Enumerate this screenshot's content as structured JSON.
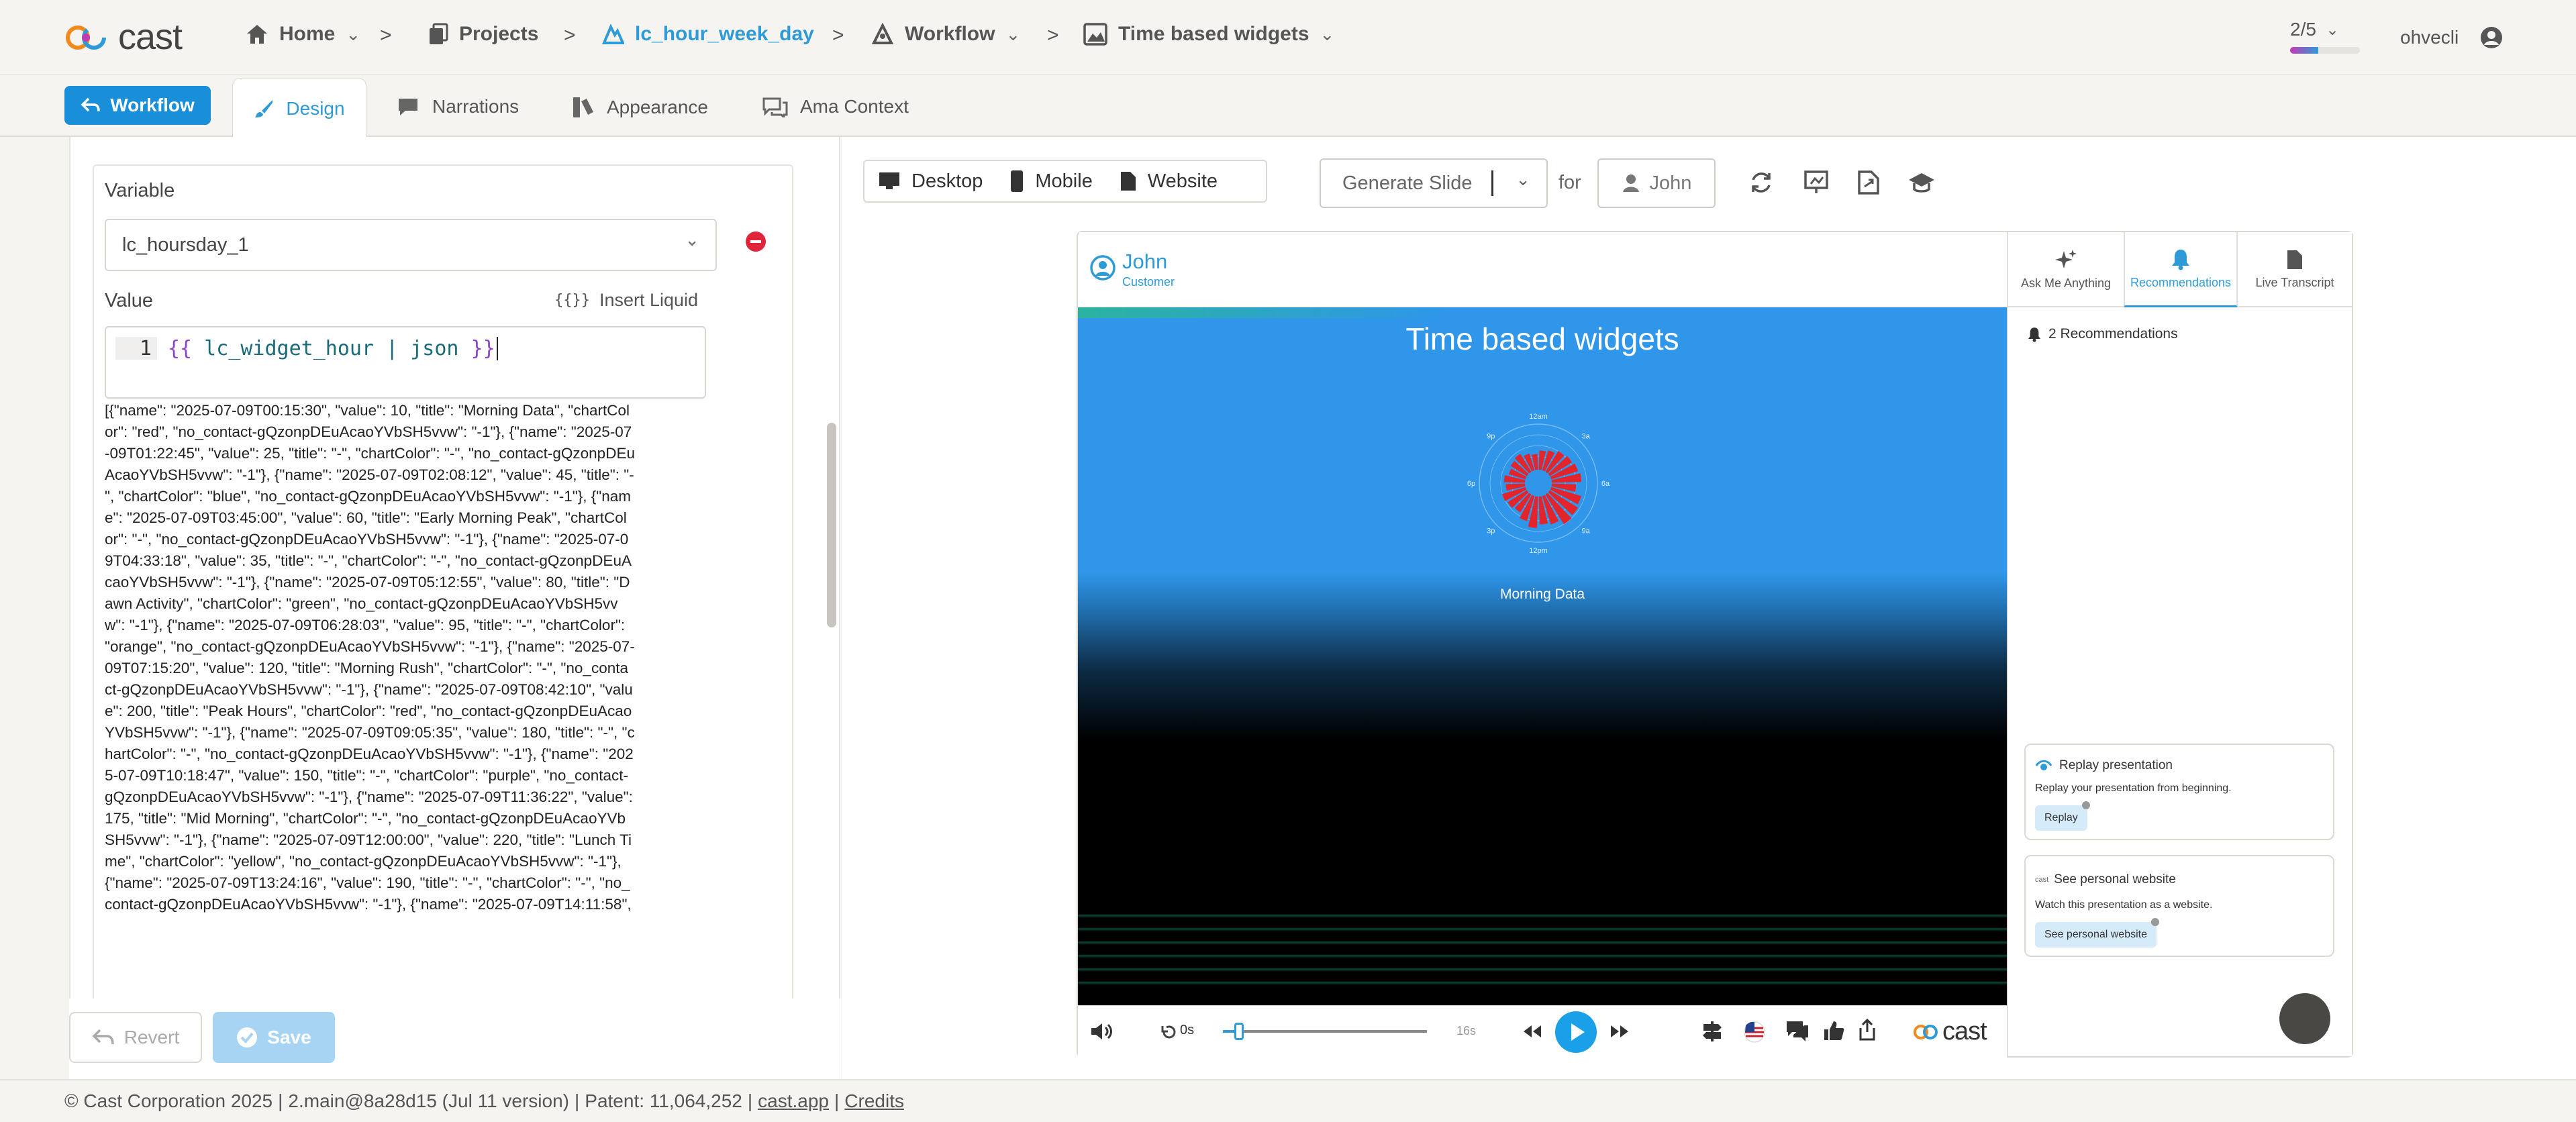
{
  "brand": {
    "logo_text": "cast"
  },
  "breadcrumb": {
    "home": "Home",
    "projects": "Projects",
    "project": "lc_hour_week_day",
    "workflow": "Workflow",
    "page": "Time based widgets"
  },
  "progress": {
    "label": "2/5",
    "fraction": 0.4
  },
  "user": {
    "name": "ohvecli"
  },
  "tabs": {
    "workflow_button": "Workflow",
    "design": "Design",
    "narrations": "Narrations",
    "appearance": "Appearance",
    "ama_context": "Ama Context"
  },
  "editor": {
    "variable_label": "Variable",
    "variable_value": "lc_hoursday_1",
    "value_label": "Value",
    "insert_liquid": "Insert Liquid",
    "insert_liquid_icon": "{{}}",
    "line_number": "1",
    "code_open": "{{",
    "code_body": " lc_widget_hour | json ",
    "code_close": "}}",
    "json_output": "[{\"name\": \"2025-07-09T00:15:30\", \"value\": 10, \"title\": \"Morning Data\", \"chartColor\": \"red\", \"no_contact-gQzonpDEuAcaoYVbSH5vvw\": \"-1\"}, {\"name\": \"2025-07-09T01:22:45\", \"value\": 25, \"title\": \"-\", \"chartColor\": \"-\", \"no_contact-gQzonpDEuAcaoYVbSH5vvw\": \"-1\"}, {\"name\": \"2025-07-09T02:08:12\", \"value\": 45, \"title\": \"-\", \"chartColor\": \"blue\", \"no_contact-gQzonpDEuAcaoYVbSH5vvw\": \"-1\"}, {\"name\": \"2025-07-09T03:45:00\", \"value\": 60, \"title\": \"Early Morning Peak\", \"chartColor\": \"-\", \"no_contact-gQzonpDEuAcaoYVbSH5vvw\": \"-1\"}, {\"name\": \"2025-07-09T04:33:18\", \"value\": 35, \"title\": \"-\", \"chartColor\": \"-\", \"no_contact-gQzonpDEuAcaoYVbSH5vvw\": \"-1\"}, {\"name\": \"2025-07-09T05:12:55\", \"value\": 80, \"title\": \"Dawn Activity\", \"chartColor\": \"green\", \"no_contact-gQzonpDEuAcaoYVbSH5vvw\": \"-1\"}, {\"name\": \"2025-07-09T06:28:03\", \"value\": 95, \"title\": \"-\", \"chartColor\": \"orange\", \"no_contact-gQzonpDEuAcaoYVbSH5vvw\": \"-1\"}, {\"name\": \"2025-07-09T07:15:20\", \"value\": 120, \"title\": \"Morning Rush\", \"chartColor\": \"-\", \"no_contact-gQzonpDEuAcaoYVbSH5vvw\": \"-1\"}, {\"name\": \"2025-07-09T08:42:10\", \"value\": 200, \"title\": \"Peak Hours\", \"chartColor\": \"red\", \"no_contact-gQzonpDEuAcaoYVbSH5vvw\": \"-1\"}, {\"name\": \"2025-07-09T09:05:35\", \"value\": 180, \"title\": \"-\", \"chartColor\": \"-\", \"no_contact-gQzonpDEuAcaoYVbSH5vvw\": \"-1\"}, {\"name\": \"2025-07-09T10:18:47\", \"value\": 150, \"title\": \"-\", \"chartColor\": \"purple\", \"no_contact-gQzonpDEuAcaoYVbSH5vvw\": \"-1\"}, {\"name\": \"2025-07-09T11:36:22\", \"value\": 175, \"title\": \"Mid Morning\", \"chartColor\": \"-\", \"no_contact-gQzonpDEuAcaoYVbSH5vvw\": \"-1\"}, {\"name\": \"2025-07-09T12:00:00\", \"value\": 220, \"title\": \"Lunch Time\", \"chartColor\": \"yellow\", \"no_contact-gQzonpDEuAcaoYVbSH5vvw\": \"-1\"}, {\"name\": \"2025-07-09T13:24:16\", \"value\": 190, \"title\": \"-\", \"chartColor\": \"-\", \"no_contact-gQzonpDEuAcaoYVbSH5vvw\": \"-1\"}, {\"name\": \"2025-07-09T14:11:58\","
  },
  "actions": {
    "revert": "Revert",
    "save": "Save"
  },
  "toolbar": {
    "desktop": "Desktop",
    "mobile": "Mobile",
    "website": "Website",
    "generate": "Generate Slide",
    "for": "for",
    "contact": "John"
  },
  "preview": {
    "contact_name": "John",
    "contact_role": "Customer",
    "side_tabs": [
      "Ask Me Anything",
      "Recommendations",
      "Live Transcript"
    ],
    "recommendations_count": "2 Recommendations",
    "slide_title": "Time based widgets",
    "chart_title": "Morning Data",
    "time_start": "0s",
    "time_end": "16s",
    "progress_fraction": 0.08,
    "replay_title": "Replay presentation",
    "replay_desc": "Replay your presentation from beginning.",
    "replay_button": "Replay",
    "website_title": "See personal website",
    "website_desc": "Watch this presentation as a website.",
    "website_button": "See personal website",
    "website_logo": "cast"
  },
  "chart_data": {
    "type": "bar",
    "subtype": "radial",
    "title": "Morning Data",
    "angle_labels": [
      "12am",
      "3a",
      "6a",
      "9a",
      "12pm",
      "3p",
      "6p",
      "9p"
    ],
    "bar_color": "#e3242b",
    "values": [
      0.55,
      0.6,
      0.7,
      0.75,
      0.8,
      0.85,
      0.7,
      0.9,
      0.95,
      1.0,
      0.85,
      0.8,
      0.9,
      0.75,
      0.6,
      0.65,
      0.7,
      0.55,
      0.6,
      0.5,
      0.55,
      0.6,
      0.5,
      0.45
    ]
  },
  "footer": {
    "copyright": "© Cast Corporation 2025",
    "version": "2.main@8a28d15 (Jul 11 version)",
    "patent": "Patent: 11,064,252",
    "link": "cast.app",
    "credits": "Credits"
  },
  "colors": {
    "accent": "#1a8fd9",
    "slide_blue": "#2f96ea",
    "bars": "#e3242b",
    "danger": "#e0243a"
  }
}
